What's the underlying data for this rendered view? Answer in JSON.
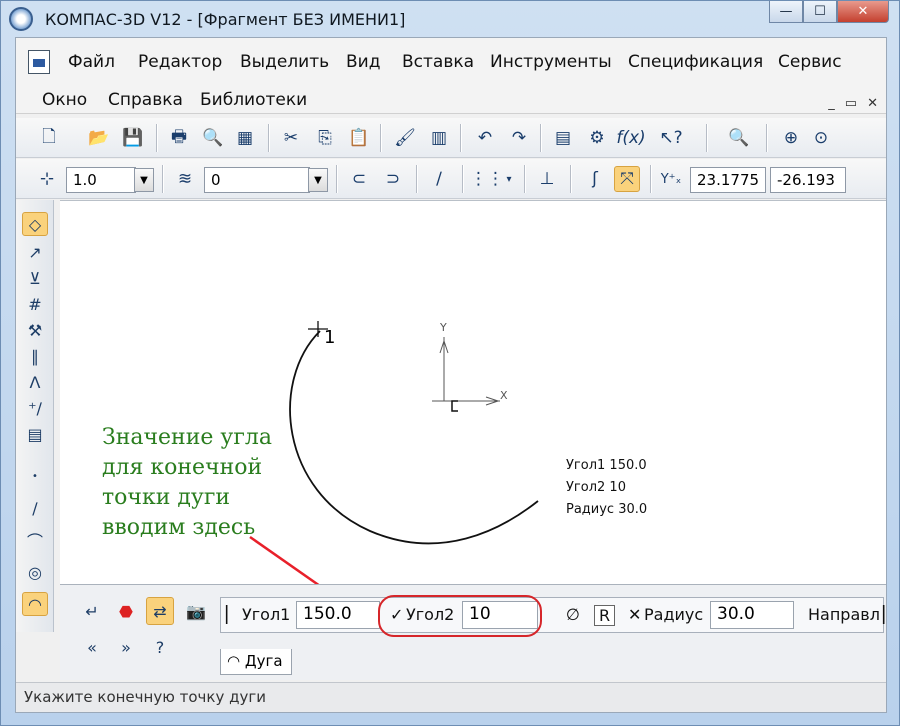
{
  "window": {
    "title": "КОМПАС-3D V12 - [Фрагмент БЕЗ ИМЕНИ1]"
  },
  "titlebar_buttons": {
    "minimize": "—",
    "maximize": "☐",
    "close": "✕"
  },
  "menu": {
    "row1": [
      "Файл",
      "Редактор",
      "Выделить",
      "Вид",
      "Вставка",
      "Инструменты",
      "Спецификация",
      "Сервис"
    ],
    "row2": [
      "Окно",
      "Справка",
      "Библиотеки"
    ]
  },
  "mdi_controls": {
    "minimize": "_",
    "restore": "▭",
    "close": "✕"
  },
  "toolbar2": {
    "scale_value": "1.0",
    "layer_value": "0",
    "coord_x": "23.1775",
    "coord_y": "-26.193"
  },
  "canvas": {
    "point_label": "1",
    "axis_x": "X",
    "axis_y": "Y",
    "hint_lines": [
      "Значение угла",
      "для конечной",
      "точки дуги",
      "вводим здесь"
    ],
    "arc_info": [
      "Угол1  150.0",
      "Угол2  10",
      "Радиус 30.0"
    ]
  },
  "properties": {
    "angle1_label": "Угол1",
    "angle1_value": "150.0",
    "angle2_label": "Угол2",
    "angle2_value": "10",
    "radius_label": "Радиус",
    "radius_value": "30.0",
    "direction_label": "Направл",
    "tab_label": "Дуга",
    "highlight_color": "#d6262a"
  },
  "status": {
    "text": "Укажите конечную точку дуги"
  },
  "colors": {
    "hint_text": "#2a7d1e",
    "arrow": "#e8202a",
    "active_button": "#fad27c"
  }
}
